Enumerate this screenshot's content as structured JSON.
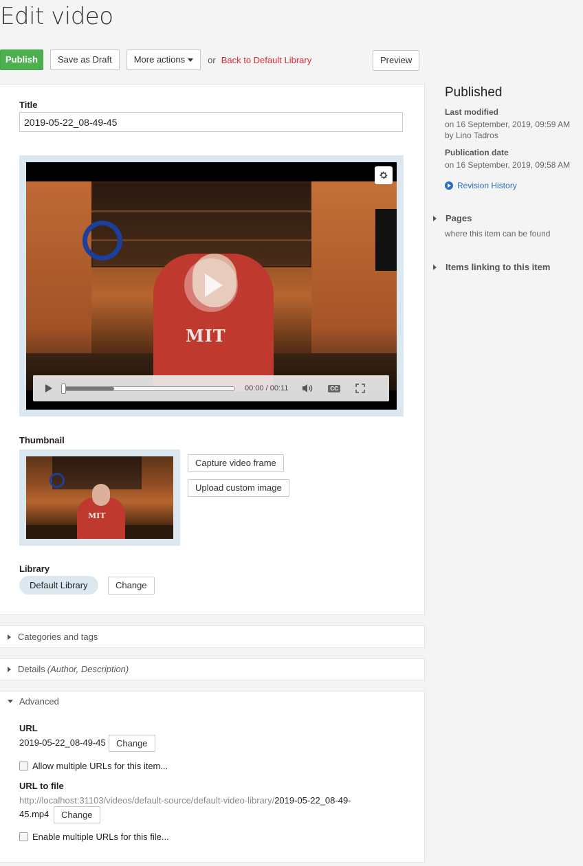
{
  "page": {
    "title": "Edit video"
  },
  "toolbar": {
    "publish": "Publish",
    "save_draft": "Save as Draft",
    "more_actions": "More actions",
    "or": "or",
    "back_link": "Back to Default Library",
    "preview": "Preview"
  },
  "form": {
    "title_label": "Title",
    "title_value": "2019-05-22_08-49-45",
    "player": {
      "time": "00:00 / 00:11",
      "progress_fraction": 0.3,
      "overlay_text": "MIT"
    },
    "thumbnail_label": "Thumbnail",
    "capture_frame": "Capture video frame",
    "upload_image": "Upload custom image",
    "library_label": "Library",
    "library_value": "Default Library",
    "library_change": "Change"
  },
  "sections": {
    "categories": "Categories and tags",
    "details": "Details",
    "details_hint": "(Author, Description)",
    "advanced": "Advanced"
  },
  "advanced": {
    "url_label": "URL",
    "url_value": "2019-05-22_08-49-45",
    "url_change": "Change",
    "allow_multiple": "Allow multiple URLs for this item...",
    "file_label": "URL to file",
    "file_url_prefix": "http://localhost:31103/videos/default-source/default-video-library/",
    "file_url_name_line1": "2019-05-22_08-49-",
    "file_url_name_line2": "45.mp4",
    "file_change": "Change",
    "enable_multiple": "Enable multiple URLs for this file..."
  },
  "sidebar": {
    "status": "Published",
    "last_modified_label": "Last modified",
    "last_modified_value": "on 16 September, 2019, 09:59 AM",
    "last_modified_by": "by Lino Tadros",
    "publication_label": "Publication date",
    "publication_value": "on 16 September, 2019, 09:58 AM",
    "revision_history": "Revision History",
    "pages_label": "Pages",
    "pages_hint": "where this item can be found",
    "items_linking": "Items linking to this item"
  },
  "colors": {
    "primary": "#4cb050",
    "link": "#2a6ebb",
    "danger_link": "#e0292f",
    "frame": "#dbe8f0"
  }
}
